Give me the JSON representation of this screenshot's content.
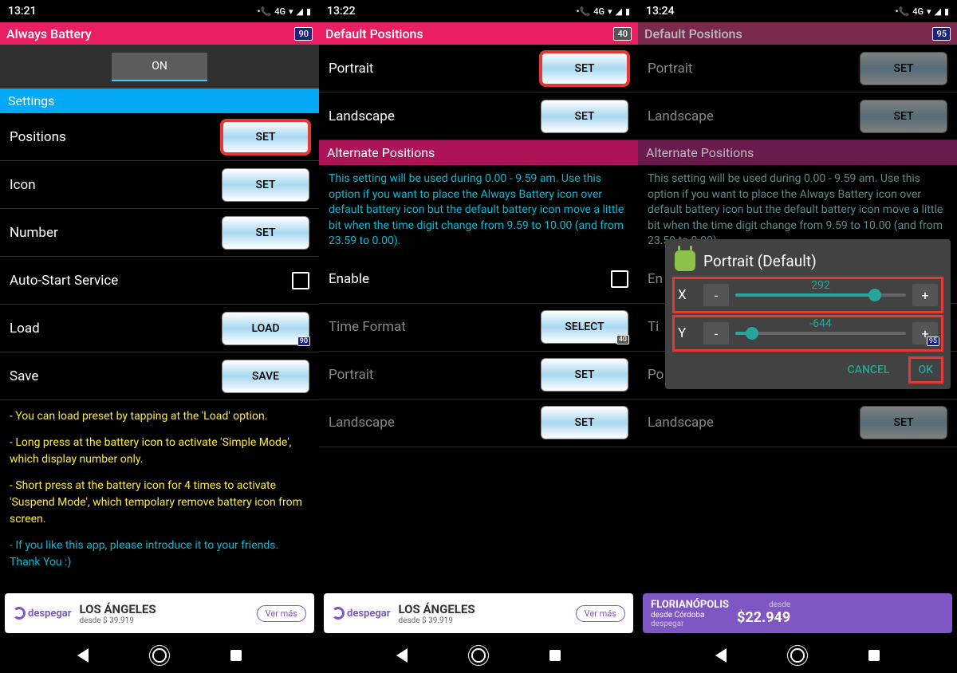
{
  "s1": {
    "time": "13:21",
    "net": "4G",
    "app_title": "Always Battery",
    "badge": "90",
    "toggle": "ON",
    "section_settings": "Settings",
    "rows": {
      "positions": "Positions",
      "icon": "Icon",
      "number": "Number",
      "autostart": "Auto-Start Service",
      "load": "Load",
      "save": "Save"
    },
    "btn_set": "SET",
    "btn_load": "LOAD",
    "btn_save": "SAVE",
    "load_badge": "90",
    "tips": [
      "- You can load preset by tapping at the 'Load' option.",
      "- Long press at the battery icon to activate 'Simple Mode', which display number only.",
      "- Short press at the battery icon for 4 times to activate 'Suspend Mode', which tempolary remove battery icon from screen.",
      "- If you like this app, please introduce it to your friends. Thank You :)"
    ]
  },
  "s2": {
    "time": "13:22",
    "net": "4G",
    "app_title": "Default Positions",
    "badge": "40",
    "rows": {
      "portrait": "Portrait",
      "landscape": "Landscape",
      "enable": "Enable",
      "time_format": "Time Format",
      "portrait2": "Portrait",
      "landscape2": "Landscape"
    },
    "section_alt": "Alternate Positions",
    "alt_desc": "This setting will be used during 0.00 - 9.59 am. Use this option if you want to place the Always Battery icon over default battery icon but the default battery icon move a little bit when the time digit change from 9.59 to 10.00 (and from 23.59 to 0.00).",
    "btn_set": "SET",
    "btn_select": "SELECT",
    "select_badge": "40"
  },
  "s3": {
    "time": "13:24",
    "net": "4G",
    "app_title": "Default Positions",
    "badge": "95",
    "rows": {
      "portrait": "Portrait",
      "landscape": "Landscape",
      "enable": "En",
      "time_format": "Ti",
      "portrait2": "Po",
      "landscape2": "Landscape"
    },
    "section_alt": "Alternate Positions",
    "alt_desc": "This setting will be used during 0.00 - 9.59 am. Use this option if you want to place the Always Battery icon over default battery icon but the default battery icon move a little bit when the time digit change from 9.59 to 10.00 (and from 23.59 to 0.00).",
    "btn_set": "SET",
    "dialog": {
      "title": "Portrait (Default)",
      "x_label": "X",
      "y_label": "Y",
      "x_val": "292",
      "y_val": "-644",
      "minus": "-",
      "plus": "+",
      "cancel": "CANCEL",
      "ok": "OK",
      "plus_badge": "95"
    }
  },
  "ad": {
    "brand": "despegar",
    "dest": "LOS ÁNGELES",
    "price_from": "desde $ 39.919",
    "cta": "Ver más"
  },
  "ad3": {
    "dest": "FLORIANÓPOLIS",
    "sub": "desde Córdoba",
    "from": "desde",
    "price": "$22.949",
    "brand": "despegar"
  }
}
